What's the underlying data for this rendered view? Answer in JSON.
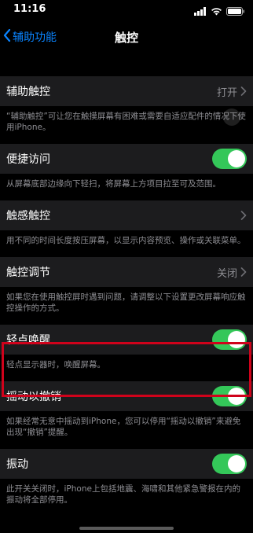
{
  "status_bar": {
    "time": "11:16"
  },
  "nav": {
    "back_label": "辅助功能",
    "title": "触控"
  },
  "sections": [
    {
      "label": "辅助触控",
      "value": "打开",
      "control": "chevron",
      "footer": "“辅助触控”可让您在触摸屏幕有困难或需要自适应配件的情况下使用iPhone。"
    },
    {
      "label": "便捷访问",
      "control": "toggle",
      "toggle_on": true,
      "footer": "从屏幕底部边缘向下轻扫，将屏幕上方项目拉至可及范围。"
    },
    {
      "label": "触感触控",
      "control": "chevron",
      "footer": "用不同的时间长度按压屏幕，以显示内容预览、操作或关联菜单。"
    },
    {
      "label": "触控调节",
      "value": "关闭",
      "control": "chevron",
      "footer": "如果您在使用触控屏时遇到问题，请调整以下设置更改屏幕响应触控操作的方式。"
    },
    {
      "label": "轻点唤醒",
      "control": "toggle",
      "toggle_on": true,
      "footer": "轻点显示器时，唤醒屏幕。"
    },
    {
      "label": "摇动以撤销",
      "control": "toggle",
      "toggle_on": true,
      "footer": "如果经常无意中摇动到iPhone，您可以停用“摇动以撤销”来避免出现“撤销”提醒。"
    },
    {
      "label": "振动",
      "control": "toggle",
      "toggle_on": true,
      "footer": "此开关关闭时，iPhone上包括地震、海啸和其他紧急警报在内的振动将全部停用。"
    }
  ],
  "colors": {
    "accent": "#0a84ff",
    "toggle_on": "#34c759",
    "highlight": "#d0021b",
    "row_bg": "#1c1c1e",
    "footer_text": "#8e8e93"
  }
}
